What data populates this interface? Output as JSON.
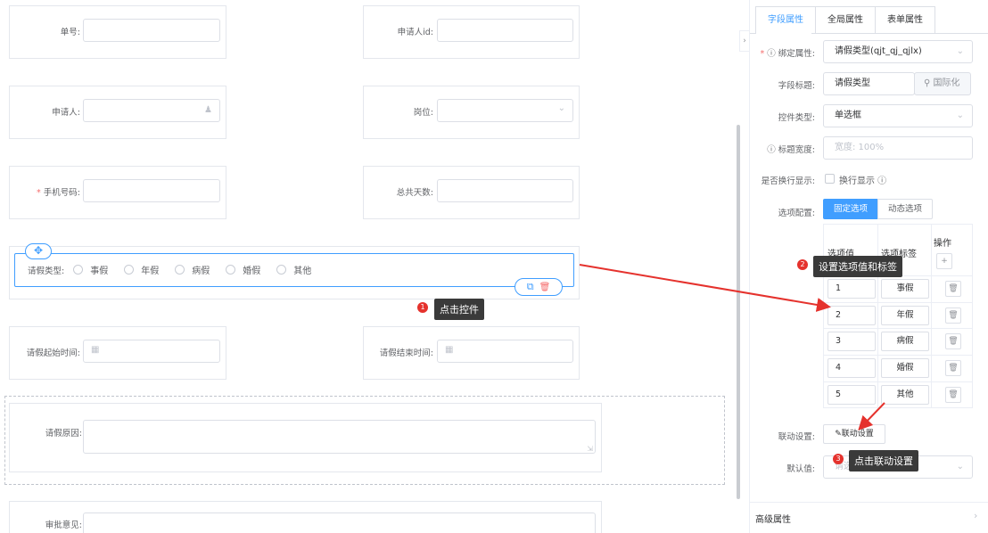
{
  "form": {
    "fields": {
      "order_no": "单号:",
      "applicant_id": "申请人id:",
      "applicant": "申请人:",
      "position": "岗位:",
      "phone": "手机号码:",
      "total_days": "总共天数:",
      "leave_type": "请假类型:",
      "start_time": "请假起始时间:",
      "end_time": "请假结束时间:",
      "reason": "请假原因:",
      "approval": "审批意见:"
    },
    "required_mark": "*",
    "leave_options": [
      "事假",
      "年假",
      "病假",
      "婚假",
      "其他"
    ]
  },
  "annotations": {
    "step1": {
      "num": "1",
      "text": "点击控件"
    },
    "step2": {
      "num": "2",
      "text": "设置选项值和标签"
    },
    "step3": {
      "num": "3",
      "text": "点击联动设置"
    }
  },
  "panel": {
    "tabs": [
      "字段属性",
      "全局属性",
      "表单属性"
    ],
    "bind_label": "绑定属性:",
    "bind_value": "请假类型(qjt_qj_qjlx)",
    "title_label": "字段标题:",
    "title_value": "请假类型",
    "i18n": "国际化",
    "control_label": "控件类型:",
    "control_value": "单选框",
    "width_label": "标题宽度:",
    "width_placeholder": "宽度: 100%",
    "wrap_label": "是否换行显示:",
    "wrap_text": "换行显示",
    "option_label": "选项配置:",
    "option_btns": [
      "固定选项",
      "动态选项"
    ],
    "table_headers": [
      "选项值",
      "选项标签",
      "操作"
    ],
    "plus": "+",
    "options": [
      {
        "value": "1",
        "label": "事假"
      },
      {
        "value": "2",
        "label": "年假"
      },
      {
        "value": "3",
        "label": "病假"
      },
      {
        "value": "4",
        "label": "婚假"
      },
      {
        "value": "5",
        "label": "其他"
      }
    ],
    "linkage_label": "联动设置:",
    "linkage_btn": "联动设置",
    "default_label": "默认值:",
    "default_placeholder": "请选择",
    "advanced": "高级属性"
  },
  "colors": {
    "accent": "#409eff",
    "annotation": "#e5322d",
    "tooltip": "#3a3a3a"
  }
}
